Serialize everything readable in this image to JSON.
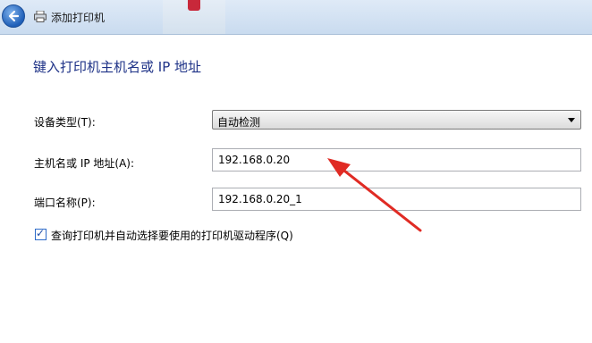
{
  "window": {
    "title": "添加打印机"
  },
  "heading": "键入打印机主机名或 IP 地址",
  "form": {
    "device_type_label": "设备类型(T):",
    "device_type_value": "自动检测",
    "hostname_label": "主机名或 IP 地址(A):",
    "hostname_value": "192.168.0.20",
    "port_label": "端口名称(P):",
    "port_value": "192.168.0.20_1",
    "query_checkbox_label": "查询打印机并自动选择要使用的打印机驱动程序(Q)",
    "query_checked": true
  },
  "annotation": {
    "color": "#e02b24"
  }
}
